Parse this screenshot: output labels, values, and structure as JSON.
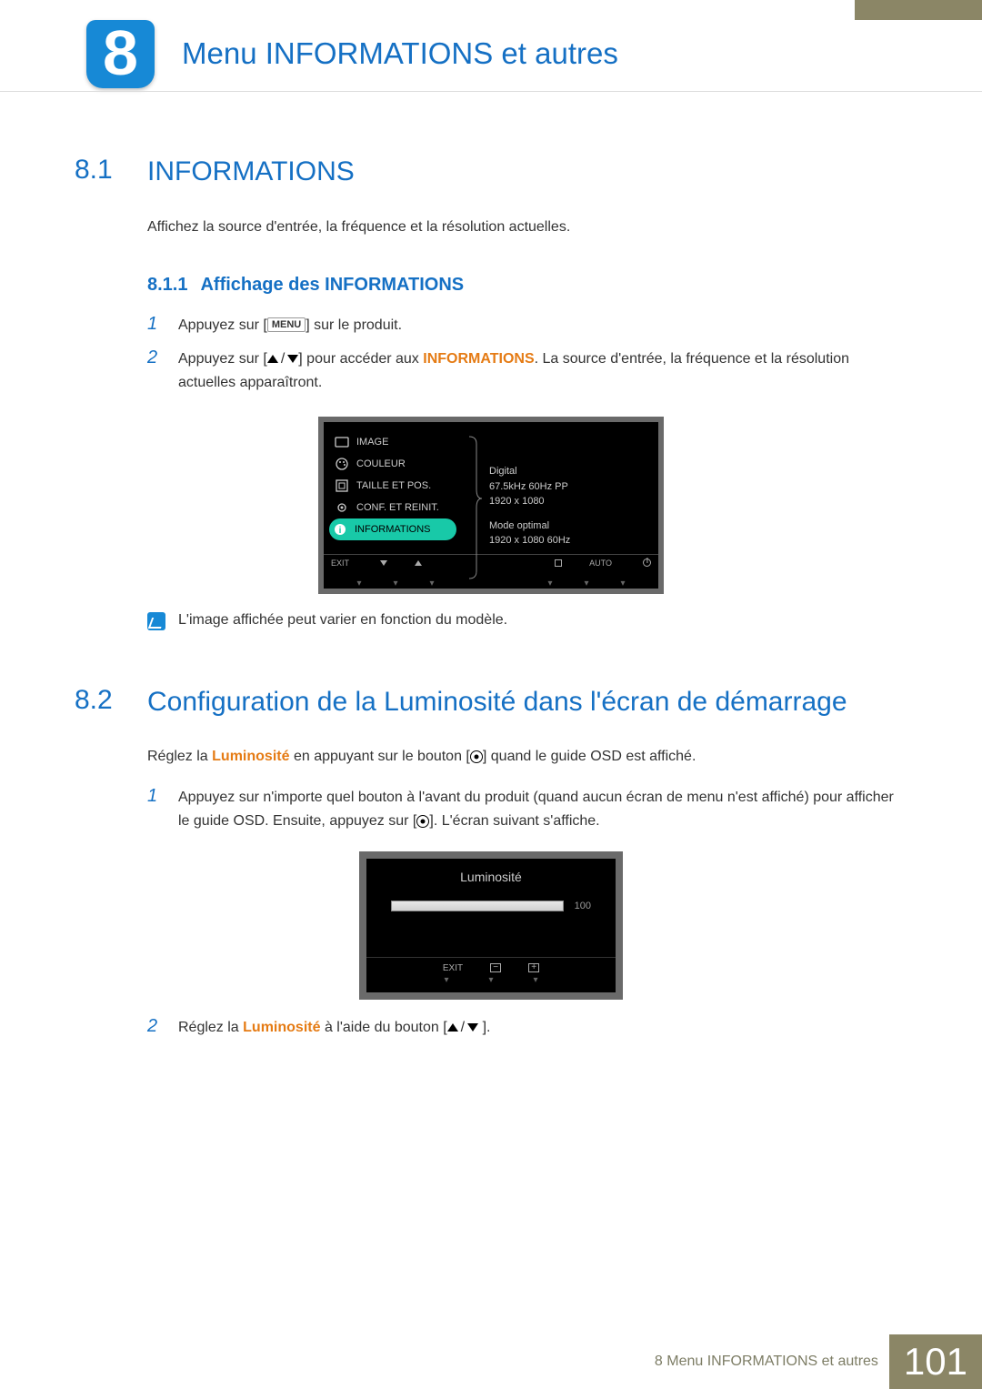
{
  "chapter": {
    "number": "8",
    "title": "Menu INFORMATIONS et autres"
  },
  "section1": {
    "num": "8.1",
    "title": "INFORMATIONS",
    "intro": "Affichez la source d'entrée, la fréquence et la résolution actuelles.",
    "sub": {
      "num": "8.1.1",
      "title": "Affichage des INFORMATIONS"
    },
    "step1_a": "Appuyez sur [",
    "step1_menu": "MENU",
    "step1_b": "] sur le produit.",
    "step2_a": "Appuyez sur [",
    "step2_b": "] pour accéder aux ",
    "step2_kw": "INFORMATIONS",
    "step2_c": ". La source d'entrée, la fréquence et la résolution actuelles apparaîtront.",
    "note": "L'image affichée peut varier en fonction du modèle."
  },
  "osd": {
    "items": [
      "IMAGE",
      "COULEUR",
      "TAILLE ET POS.",
      "CONF. ET REINIT.",
      "INFORMATIONS"
    ],
    "info1": "Digital",
    "info2": "67.5kHz 60Hz PP",
    "info3": "1920 x 1080",
    "info4": "Mode optimal",
    "info5": "1920 x 1080 60Hz",
    "bar": {
      "exit": "EXIT",
      "auto": "AUTO"
    }
  },
  "section2": {
    "num": "8.2",
    "title": "Configuration de la Luminosité dans l'écran de démarrage",
    "intro_a": "Réglez la ",
    "intro_kw": "Luminosité",
    "intro_b": " en appuyant sur le bouton [",
    "intro_c": "] quand le guide OSD est affiché.",
    "step1_a": "Appuyez sur n'importe quel bouton à l'avant du produit (quand aucun écran de menu n'est affiché) pour afficher le guide OSD. Ensuite, appuyez sur [",
    "step1_b": "]. L'écran suivant s'affiche.",
    "step2_a": "Réglez la ",
    "step2_kw": "Luminosité",
    "step2_b": " à l'aide du bouton [",
    "step2_c": " ]."
  },
  "luminosite": {
    "title": "Luminosité",
    "value": "100",
    "exit": "EXIT"
  },
  "footer": {
    "label": "8 Menu INFORMATIONS et autres",
    "page": "101"
  }
}
